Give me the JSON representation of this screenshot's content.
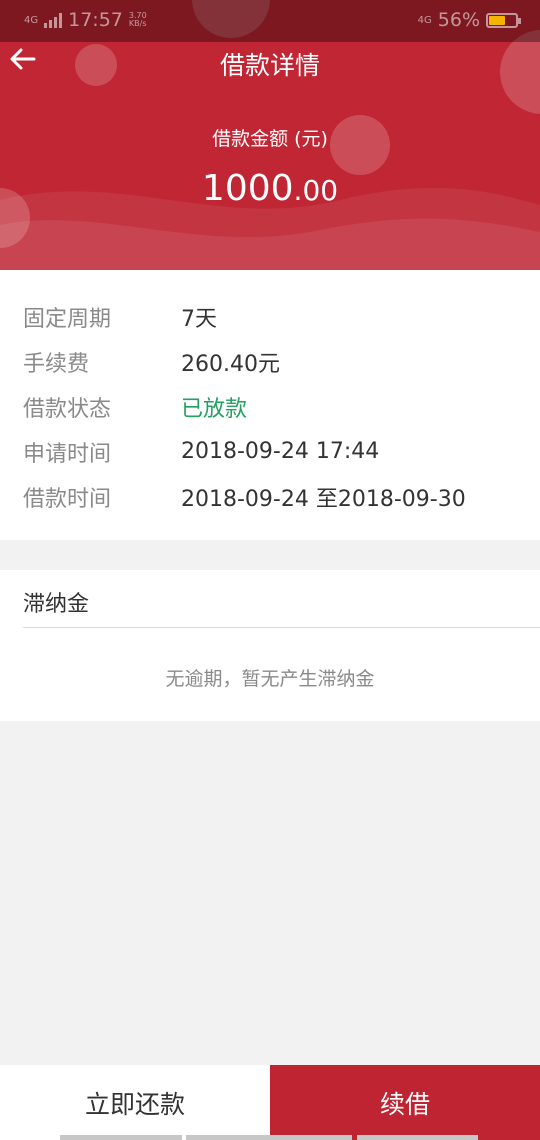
{
  "status_bar": {
    "network_left": "4G",
    "time": "17:57",
    "speed_value": "3.70",
    "speed_unit": "KB/s",
    "network_right": "4G",
    "battery": "56%",
    "battery_level": 0.56
  },
  "header": {
    "title": "借款详情",
    "amount_label": "借款金额 (元)",
    "amount_integer": "1000",
    "amount_decimal": ".00"
  },
  "details": {
    "rows": [
      {
        "label": "固定周期",
        "value": "7天"
      },
      {
        "label": "手续费",
        "value": "260.40元"
      },
      {
        "label": "借款状态",
        "value": "已放款"
      },
      {
        "label": "申请时间",
        "value": "2018-09-24 17:44"
      },
      {
        "label": "借款时间",
        "value": "2018-09-24 至2018-09-30"
      }
    ]
  },
  "late_fee": {
    "title": "滞纳金",
    "empty_text": "无逾期，暂无产生滞纳金"
  },
  "actions": {
    "repay_label": "立即还款",
    "renew_label": "续借"
  },
  "colors": {
    "brand": "#c02634",
    "status_green": "#22a060"
  }
}
